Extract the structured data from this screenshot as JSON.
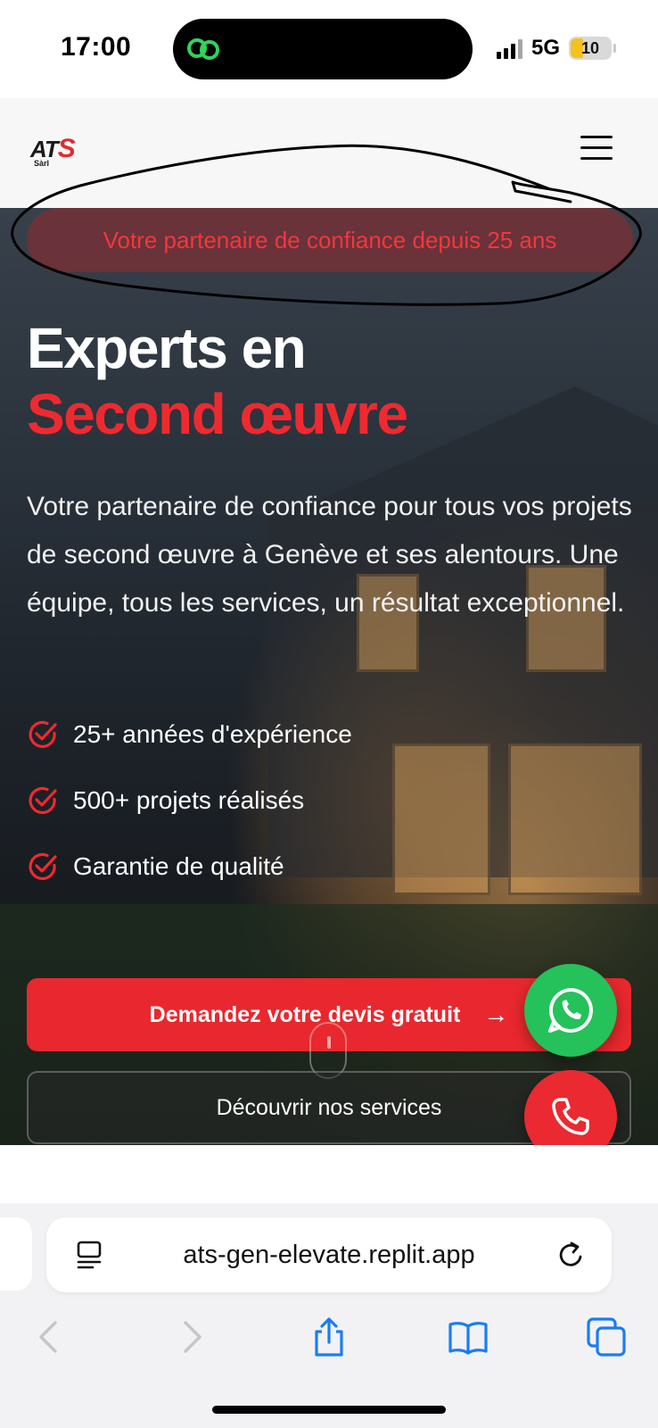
{
  "status_bar": {
    "time": "17:00",
    "network": "5G",
    "battery": "10"
  },
  "header": {
    "logo_main": "ATS",
    "logo_sub": "Sàrl"
  },
  "hero": {
    "badge": "Votre partenaire de confiance depuis 25 ans",
    "title_line1": "Experts en",
    "title_line2": "Second œuvre",
    "description": "Votre partenaire de confiance pour tous vos projets de second œuvre à Genève et ses alentours. Une équipe, tous les services, un résultat exceptionnel.",
    "features": [
      "25+ années d'expérience",
      "500+ projets réalisés",
      "Garantie de qualité"
    ],
    "cta_primary": "Demandez votre devis gratuit",
    "cta_secondary": "Découvrir nos services"
  },
  "browser": {
    "url": "ats-gen-elevate.replit.app"
  },
  "colors": {
    "accent_red": "#e8282e",
    "whatsapp_green": "#25c15b"
  }
}
